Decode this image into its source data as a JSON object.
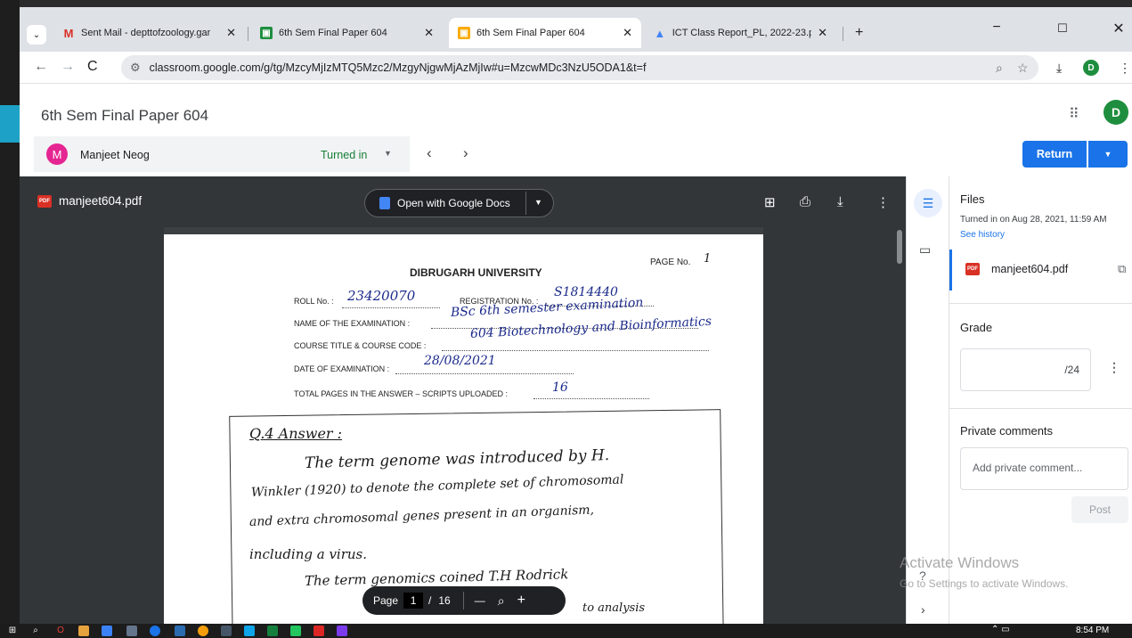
{
  "browser": {
    "tabs": [
      {
        "title": "Sent Mail - depttofzoology.gar",
        "icon": "gmail-icon"
      },
      {
        "title": "6th Sem Final Paper 604",
        "icon": "classroom-icon"
      },
      {
        "title": "6th Sem Final Paper 604",
        "icon": "classroom-icon",
        "active": true
      },
      {
        "title": "ICT Class Report_PL, 2022-23.p",
        "icon": "drive-icon"
      }
    ],
    "new_tab": "+",
    "url": "classroom.google.com/g/tg/MzcyMjIzMTQ5Mzc2/MzgyNjgwMjAzMjIw#u=MzcwMDc3NzU5ODA1&t=f",
    "profile_initial": "D"
  },
  "classroom": {
    "title": "6th Sem Final Paper 604",
    "avatar_initial": "D",
    "student": {
      "initial": "M",
      "name": "Manjeet Neog",
      "status": "Turned in"
    },
    "return_label": "Return"
  },
  "viewer": {
    "filename": "manjeet604.pdf",
    "open_with": "Open with Google Docs",
    "page_label": "Page",
    "page_current": "1",
    "page_separator": "/",
    "page_total": "16",
    "zoom_out": "—",
    "zoom_in": "+"
  },
  "document": {
    "page_no_label": "PAGE No.",
    "page_no_value": "1",
    "university": "DIBRUGARH UNIVERSITY",
    "roll_label": "ROLL No. :",
    "roll_value": "23420070",
    "reg_label": "REGISTRATION No. :",
    "reg_value": "S1814440",
    "exam_label": "NAME OF THE EXAMINATION :",
    "exam_value": "BSc 6th semester examination",
    "course_label": "COURSE TITLE & COURSE CODE :",
    "course_value": "604  Biotechnology and Bioinformatics",
    "date_label": "DATE OF EXAMINATION :",
    "date_value": "28/08/2021",
    "pages_label": "TOTAL PAGES IN THE ANSWER – SCRIPTS UPLOADED :",
    "pages_value": "16",
    "answer_heading": "Q.4 Answer :",
    "answer_lines": [
      "The term genome was introduced by H.",
      "Winkler (1920) to denote the complete set of chromosomal",
      "and extra chromosomal genes present in an organism,",
      "including a virus.",
      "The term genomics coined T.H Rodrick",
      "to analysis"
    ]
  },
  "panel": {
    "files_title": "Files",
    "turned_in_text": "Turned in on Aug 28, 2021, 11:59 AM",
    "see_history": "See history",
    "file_name": "manjeet604.pdf",
    "grade_title": "Grade",
    "grade_value": "/24",
    "comments_title": "Private comments",
    "comment_placeholder": "Add private comment...",
    "post_label": "Post"
  },
  "watermark": {
    "line1": "Activate Windows",
    "line2": "Go to Settings to activate Windows."
  },
  "taskbar": {
    "time": "8:54 PM"
  }
}
